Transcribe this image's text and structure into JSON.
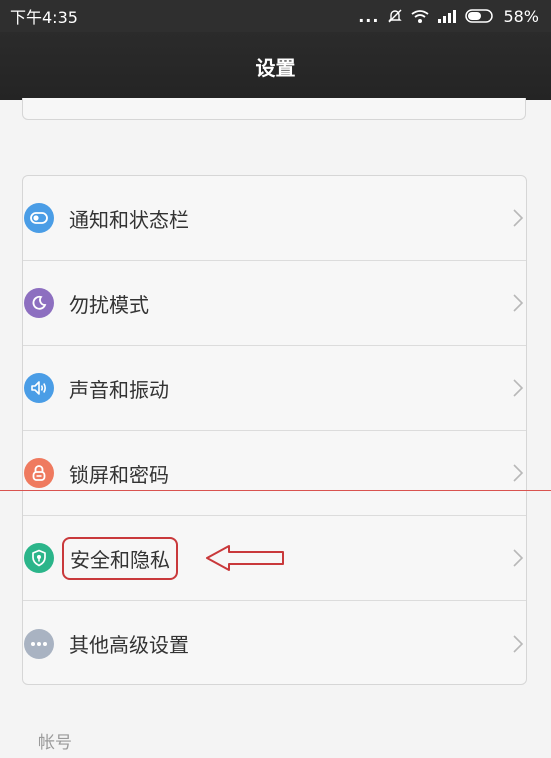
{
  "status_bar": {
    "time": "下午4:35",
    "signal_dots": "...",
    "battery_percent": "58%"
  },
  "header": {
    "title": "设置"
  },
  "settings_group": {
    "items": [
      {
        "label": "通知和状态栏",
        "icon": "toggle-icon",
        "color": "#4a9de6"
      },
      {
        "label": "勿扰模式",
        "icon": "moon-icon",
        "color": "#8d6fc0"
      },
      {
        "label": "声音和振动",
        "icon": "speaker-icon",
        "color": "#4a9de6"
      },
      {
        "label": "锁屏和密码",
        "icon": "lock-icon",
        "color": "#ef7a5f"
      },
      {
        "label": "安全和隐私",
        "icon": "shield-icon",
        "color": "#2bb58a"
      },
      {
        "label": "其他高级设置",
        "icon": "more-dots-icon",
        "color": "#a9b3c2"
      }
    ]
  },
  "annotations": {
    "highlight_color": "#c9393b"
  },
  "section_header": {
    "label": "帐号"
  }
}
